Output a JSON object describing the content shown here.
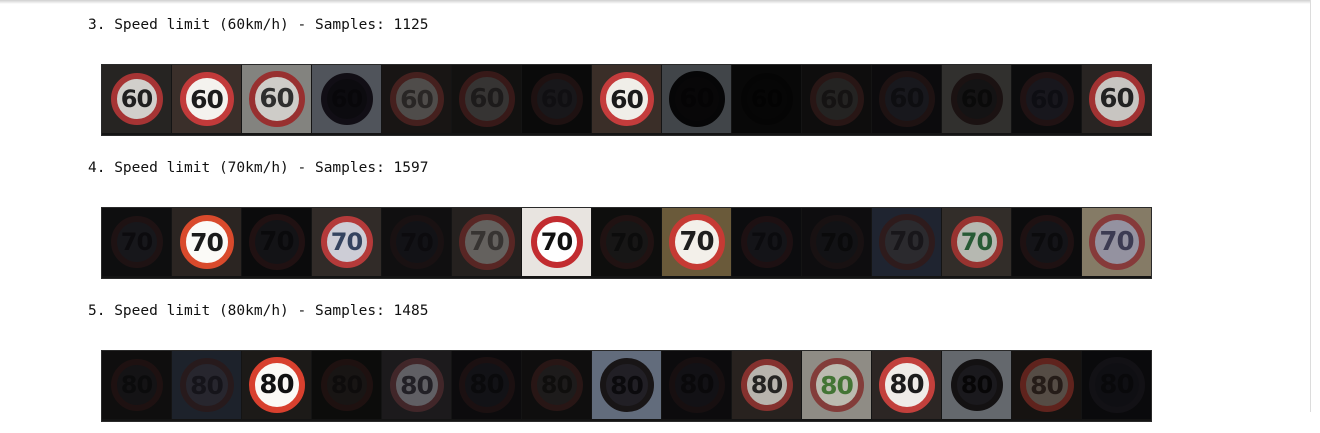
{
  "sections": [
    {
      "title": "3. Speed limit (60km/h) - Samples: 1125",
      "sign_value": "60",
      "tiles": [
        {
          "bg": "#2a2826",
          "ring": "#b83a3a",
          "face": "#e8e6e2",
          "text": "#222",
          "brightness": 0.9
        },
        {
          "bg": "#3a2f2a",
          "ring": "#c23a3a",
          "face": "#f4f2ee",
          "text": "#1c1c1c",
          "brightness": 1.0
        },
        {
          "bg": "#8a8a86",
          "ring": "#a03232",
          "face": "#d9d7d2",
          "text": "#303030",
          "brightness": 0.95
        },
        {
          "bg": "#c9d2e3",
          "ring": "#2a2434",
          "face": "#1e1b26",
          "text": "#14121a",
          "brightness": 0.4
        },
        {
          "bg": "#2b2725",
          "ring": "#7d3a36",
          "face": "#8f8a86",
          "text": "#4a4644",
          "brightness": 0.55
        },
        {
          "bg": "#242221",
          "ring": "#6e3230",
          "face": "#6c6865",
          "text": "#3a3635",
          "brightness": 0.5
        },
        {
          "bg": "#1a1918",
          "ring": "#4a2a2a",
          "face": "#3b3940",
          "text": "#27252c",
          "brightness": 0.4
        },
        {
          "bg": "#3a2e28",
          "ring": "#c43c3c",
          "face": "#f0eee8",
          "text": "#1a1a1a",
          "brightness": 1.0
        },
        {
          "bg": "#d8e6f4",
          "ring": "#151418",
          "face": "#19181c",
          "text": "#0f0e10",
          "brightness": 0.3
        },
        {
          "bg": "#1b1a19",
          "ring": "#121111",
          "face": "#151414",
          "text": "#0b0b0b",
          "brightness": 0.3
        },
        {
          "bg": "#1f1d1c",
          "ring": "#5a302e",
          "face": "#514d4b",
          "text": "#2e2b2a",
          "brightness": 0.45
        },
        {
          "bg": "#1d1c20",
          "ring": "#4a2c2e",
          "face": "#3d3b48",
          "text": "#23222a",
          "brightness": 0.4
        },
        {
          "bg": "#6c6a66",
          "ring": "#3c2827",
          "face": "#2d2b2c",
          "text": "#171616",
          "brightness": 0.45
        },
        {
          "bg": "#1e1d20",
          "ring": "#4f2d2f",
          "face": "#3c3a48",
          "text": "#242230",
          "brightness": 0.4
        },
        {
          "bg": "#2c2826",
          "ring": "#b33838",
          "face": "#dedbd6",
          "text": "#262626",
          "brightness": 0.9
        }
      ]
    },
    {
      "title": "4. Speed limit (70km/h) - Samples: 1597",
      "sign_value": "70",
      "tiles": [
        {
          "bg": "#232226",
          "ring": "#4a2d30",
          "face": "#3a3944",
          "text": "#1d1c24",
          "brightness": 0.4
        },
        {
          "bg": "#2b2522",
          "ring": "#d94a2c",
          "face": "#fbfaf7",
          "text": "#1b1b1b",
          "brightness": 1.0
        },
        {
          "bg": "#1c1b1d",
          "ring": "#4f2a2c",
          "face": "#302f37",
          "text": "#1a191e",
          "brightness": 0.4
        },
        {
          "bg": "#36302c",
          "ring": "#c84040",
          "face": "#e4e4ee",
          "text": "#3a4a6a",
          "brightness": 0.9
        },
        {
          "bg": "#272628",
          "ring": "#3f2a2d",
          "face": "#2e2d38",
          "text": "#1d1c24",
          "brightness": 0.4
        },
        {
          "bg": "#3d3734",
          "ring": "#93403c",
          "face": "#a7a19d",
          "text": "#5b5653",
          "brightness": 0.6
        },
        {
          "bg": "#e8e4e0",
          "ring": "#c22c30",
          "face": "#ffffff",
          "text": "#111111",
          "brightness": 1.0
        },
        {
          "bg": "#242220",
          "ring": "#4f2e2c",
          "face": "#3a3836",
          "text": "#1f1e1d",
          "brightness": 0.4
        },
        {
          "bg": "#6a5a3a",
          "ring": "#c63a34",
          "face": "#f3f0ea",
          "text": "#1e1e1e",
          "brightness": 1.0
        },
        {
          "bg": "#1f1e22",
          "ring": "#48292c",
          "face": "#33323c",
          "text": "#1c1b22",
          "brightness": 0.4
        },
        {
          "bg": "#222125",
          "ring": "#3d2a2d",
          "face": "#2e2d34",
          "text": "#19181c",
          "brightness": 0.4
        },
        {
          "bg": "#3e4760",
          "ring": "#5b3538",
          "face": "#56535c",
          "text": "#2f2d34",
          "brightness": 0.5
        },
        {
          "bg": "#3b3530",
          "ring": "#b33c38",
          "face": "#d6d9d0",
          "text": "#2e6a3e",
          "brightness": 0.85
        },
        {
          "bg": "#1e1d21",
          "ring": "#4a2b2e",
          "face": "#33323b",
          "text": "#1c1b20",
          "brightness": 0.4
        },
        {
          "bg": "#a69a80",
          "ring": "#a84848",
          "face": "#b9b7c8",
          "text": "#4b4a66",
          "brightness": 0.8
        }
      ]
    },
    {
      "title": "5. Speed limit (80km/h) - Samples: 1485",
      "sign_value": "80",
      "tiles": [
        {
          "bg": "#252322",
          "ring": "#4a2b2a",
          "face": "#312f34",
          "text": "#1c1b1e",
          "brightness": 0.4
        },
        {
          "bg": "#3a4356",
          "ring": "#4e3438",
          "face": "#4e4c5c",
          "text": "#2a2834",
          "brightness": 0.5
        },
        {
          "bg": "#1c1a18",
          "ring": "#d8402e",
          "face": "#fbf9f5",
          "text": "#111111",
          "brightness": 1.0
        },
        {
          "bg": "#1f1d1c",
          "ring": "#4c2a28",
          "face": "#3b3433",
          "text": "#241f1e",
          "brightness": 0.4
        },
        {
          "bg": "#2e2c2e",
          "ring": "#6d4044",
          "face": "#a09ea6",
          "text": "#383640",
          "brightness": 0.6
        },
        {
          "bg": "#1d1c20",
          "ring": "#43282b",
          "face": "#2e2d36",
          "text": "#1a191e",
          "brightness": 0.4
        },
        {
          "bg": "#221f1e",
          "ring": "#58302f",
          "face": "#413d3c",
          "text": "#211e1d",
          "brightness": 0.45
        },
        {
          "bg": "#b3c5e2",
          "ring": "#2c2628",
          "face": "#3c3944",
          "text": "#141318",
          "brightness": 0.55
        },
        {
          "bg": "#1d1c20",
          "ring": "#3a2629",
          "face": "#2c2b34",
          "text": "#18171c",
          "brightness": 0.4
        },
        {
          "bg": "#2f2825",
          "ring": "#9c3a36",
          "face": "#d8d4cc",
          "text": "#2c2a28",
          "brightness": 0.85
        },
        {
          "bg": "#a8a59c",
          "ring": "#9a4844",
          "face": "#dcdccf",
          "text": "#4f8a3e",
          "brightness": 0.85
        },
        {
          "bg": "#2c2624",
          "ring": "#c2403c",
          "face": "#efece8",
          "text": "#1c1c1c",
          "brightness": 1.0
        },
        {
          "bg": "#dfe6f2",
          "ring": "#2a2528",
          "face": "#3a3740",
          "text": "#0f0e10",
          "brightness": 0.45
        },
        {
          "bg": "#241f1c",
          "ring": "#9e3b30",
          "face": "#8e7e73",
          "text": "#3d2f28",
          "brightness": 0.6
        },
        {
          "bg": "#1a1a1e",
          "ring": "#2e2a34",
          "face": "#262530",
          "text": "#17161c",
          "brightness": 0.4
        }
      ]
    }
  ]
}
